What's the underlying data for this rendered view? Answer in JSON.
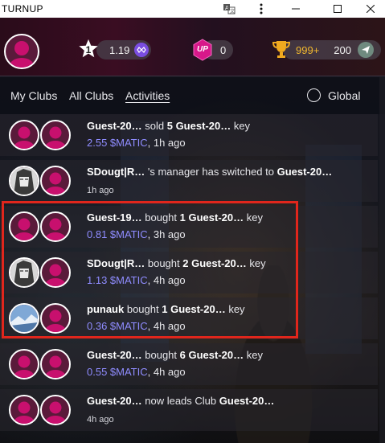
{
  "window": {
    "title": "TURNUP",
    "icons": [
      "translate-icon",
      "kebab-menu-icon",
      "minimize-icon",
      "maximize-icon",
      "close-icon"
    ]
  },
  "header": {
    "level_value": "1",
    "matic_balance": "1.19",
    "up_badge_text": "UP",
    "up_value": "0",
    "trophy_points": "999+",
    "coin_value": "200"
  },
  "tabs": {
    "items": [
      {
        "label": "My Clubs",
        "active": false
      },
      {
        "label": "All Clubs",
        "active": false
      },
      {
        "label": "Activities",
        "active": true
      }
    ],
    "global_label": "Global"
  },
  "activities": [
    {
      "avatar_left": "default",
      "actor": "Guest-20…",
      "verb": " sold ",
      "qty": "5",
      "target": " Guest-20…",
      "suffix": " key",
      "price": "2.55 $MATIC",
      "time": ", 1h ago"
    },
    {
      "avatar_left": "anime",
      "actor": "SDougt|R…",
      "verb": " 's manager has switched to ",
      "qty": "",
      "target": "Guest-20…",
      "suffix": "",
      "price": "",
      "time": "1h ago"
    },
    {
      "avatar_left": "default",
      "actor": "Guest-19…",
      "verb": " bought ",
      "qty": "1",
      "target": " Guest-20…",
      "suffix": " key",
      "price": "0.81 $MATIC",
      "time": ", 3h ago"
    },
    {
      "avatar_left": "anime",
      "actor": "SDougt|R…",
      "verb": " bought ",
      "qty": "2",
      "target": " Guest-20…",
      "suffix": " key",
      "price": "1.13 $MATIC",
      "time": ", 4h ago"
    },
    {
      "avatar_left": "photo",
      "actor": "punauk",
      "verb": " bought ",
      "qty": "1",
      "target": " Guest-20…",
      "suffix": " key",
      "price": "0.36 $MATIC",
      "time": ", 4h ago"
    },
    {
      "avatar_left": "default",
      "actor": "Guest-20…",
      "verb": " bought ",
      "qty": "6",
      "target": " Guest-20…",
      "suffix": " key",
      "price": "0.55 $MATIC",
      "time": ", 4h ago"
    },
    {
      "avatar_left": "default",
      "actor": "Guest-20…",
      "verb": " now leads Club ",
      "qty": "",
      "target": "Guest-20…",
      "suffix": "",
      "price": "",
      "time": "4h ago"
    }
  ],
  "colors": {
    "accent_matic": "#8f8cff",
    "highlight": "#e0261c",
    "avatar_magenta": "#c8106e"
  }
}
